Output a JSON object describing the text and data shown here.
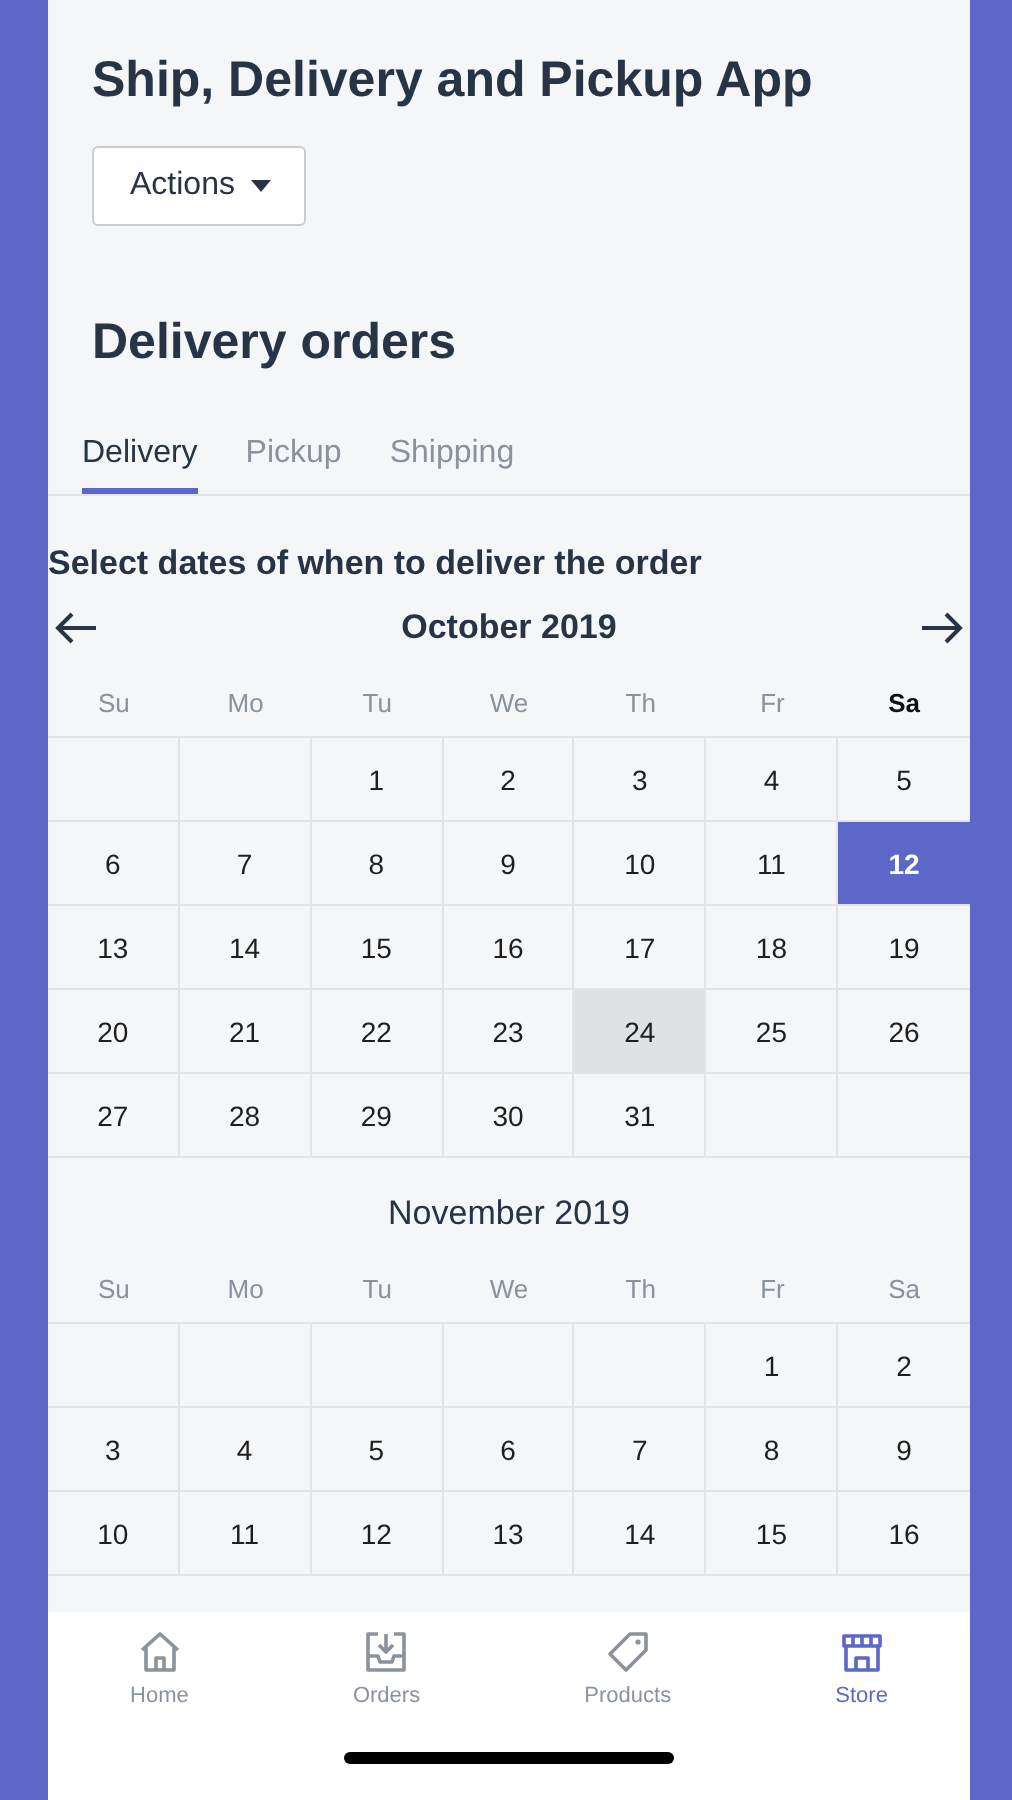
{
  "app_title": "Ship, Delivery and Pickup App",
  "actions_button": {
    "label": "Actions"
  },
  "section_title": "Delivery orders",
  "tabs": [
    {
      "label": "Delivery",
      "selected": true
    },
    {
      "label": "Pickup",
      "selected": false
    },
    {
      "label": "Shipping",
      "selected": false
    }
  ],
  "instruction": "Select dates of when to deliver the order",
  "months": [
    {
      "title": "October 2019",
      "navigation": true,
      "weekdays": [
        {
          "label": "Su",
          "emphasized": false
        },
        {
          "label": "Mo",
          "emphasized": false
        },
        {
          "label": "Tu",
          "emphasized": false
        },
        {
          "label": "We",
          "emphasized": false
        },
        {
          "label": "Th",
          "emphasized": false
        },
        {
          "label": "Fr",
          "emphasized": false
        },
        {
          "label": "Sa",
          "emphasized": true
        }
      ],
      "weeks": [
        [
          {
            "kind": "blank"
          },
          {
            "kind": "blank"
          },
          {
            "kind": "day",
            "day": "1",
            "selected": false,
            "highlighted": false
          },
          {
            "kind": "day",
            "day": "2",
            "selected": false,
            "highlighted": false
          },
          {
            "kind": "day",
            "day": "3",
            "selected": false,
            "highlighted": false
          },
          {
            "kind": "day",
            "day": "4",
            "selected": false,
            "highlighted": false
          },
          {
            "kind": "day",
            "day": "5",
            "selected": false,
            "highlighted": false
          }
        ],
        [
          {
            "kind": "day",
            "day": "6",
            "selected": false,
            "highlighted": false
          },
          {
            "kind": "day",
            "day": "7",
            "selected": false,
            "highlighted": false
          },
          {
            "kind": "day",
            "day": "8",
            "selected": false,
            "highlighted": false
          },
          {
            "kind": "day",
            "day": "9",
            "selected": false,
            "highlighted": false
          },
          {
            "kind": "day",
            "day": "10",
            "selected": false,
            "highlighted": false
          },
          {
            "kind": "day",
            "day": "11",
            "selected": false,
            "highlighted": false
          },
          {
            "kind": "day",
            "day": "12",
            "selected": true,
            "highlighted": false
          }
        ],
        [
          {
            "kind": "day",
            "day": "13",
            "selected": false,
            "highlighted": false
          },
          {
            "kind": "day",
            "day": "14",
            "selected": false,
            "highlighted": false
          },
          {
            "kind": "day",
            "day": "15",
            "selected": false,
            "highlighted": false
          },
          {
            "kind": "day",
            "day": "16",
            "selected": false,
            "highlighted": false
          },
          {
            "kind": "day",
            "day": "17",
            "selected": false,
            "highlighted": false
          },
          {
            "kind": "day",
            "day": "18",
            "selected": false,
            "highlighted": false
          },
          {
            "kind": "day",
            "day": "19",
            "selected": false,
            "highlighted": false
          }
        ],
        [
          {
            "kind": "day",
            "day": "20",
            "selected": false,
            "highlighted": false
          },
          {
            "kind": "day",
            "day": "21",
            "selected": false,
            "highlighted": false
          },
          {
            "kind": "day",
            "day": "22",
            "selected": false,
            "highlighted": false
          },
          {
            "kind": "day",
            "day": "23",
            "selected": false,
            "highlighted": false
          },
          {
            "kind": "day",
            "day": "24",
            "selected": false,
            "highlighted": true
          },
          {
            "kind": "day",
            "day": "25",
            "selected": false,
            "highlighted": false
          },
          {
            "kind": "day",
            "day": "26",
            "selected": false,
            "highlighted": false
          }
        ],
        [
          {
            "kind": "day",
            "day": "27",
            "selected": false,
            "highlighted": false
          },
          {
            "kind": "day",
            "day": "28",
            "selected": false,
            "highlighted": false
          },
          {
            "kind": "day",
            "day": "29",
            "selected": false,
            "highlighted": false
          },
          {
            "kind": "day",
            "day": "30",
            "selected": false,
            "highlighted": false
          },
          {
            "kind": "day",
            "day": "31",
            "selected": false,
            "highlighted": false
          },
          {
            "kind": "blank"
          },
          {
            "kind": "blank"
          }
        ]
      ]
    },
    {
      "title": "November 2019",
      "navigation": false,
      "weekdays": [
        {
          "label": "Su",
          "emphasized": false
        },
        {
          "label": "Mo",
          "emphasized": false
        },
        {
          "label": "Tu",
          "emphasized": false
        },
        {
          "label": "We",
          "emphasized": false
        },
        {
          "label": "Th",
          "emphasized": false
        },
        {
          "label": "Fr",
          "emphasized": false
        },
        {
          "label": "Sa",
          "emphasized": false
        }
      ],
      "weeks": [
        [
          {
            "kind": "blank"
          },
          {
            "kind": "blank"
          },
          {
            "kind": "blank"
          },
          {
            "kind": "blank"
          },
          {
            "kind": "blank"
          },
          {
            "kind": "day",
            "day": "1",
            "selected": false,
            "highlighted": false
          },
          {
            "kind": "day",
            "day": "2",
            "selected": false,
            "highlighted": false
          }
        ],
        [
          {
            "kind": "day",
            "day": "3",
            "selected": false,
            "highlighted": false
          },
          {
            "kind": "day",
            "day": "4",
            "selected": false,
            "highlighted": false
          },
          {
            "kind": "day",
            "day": "5",
            "selected": false,
            "highlighted": false
          },
          {
            "kind": "day",
            "day": "6",
            "selected": false,
            "highlighted": false
          },
          {
            "kind": "day",
            "day": "7",
            "selected": false,
            "highlighted": false
          },
          {
            "kind": "day",
            "day": "8",
            "selected": false,
            "highlighted": false
          },
          {
            "kind": "day",
            "day": "9",
            "selected": false,
            "highlighted": false
          }
        ],
        [
          {
            "kind": "day",
            "day": "10",
            "selected": false,
            "highlighted": false
          },
          {
            "kind": "day",
            "day": "11",
            "selected": false,
            "highlighted": false
          },
          {
            "kind": "day",
            "day": "12",
            "selected": false,
            "highlighted": false
          },
          {
            "kind": "day",
            "day": "13",
            "selected": false,
            "highlighted": false
          },
          {
            "kind": "day",
            "day": "14",
            "selected": false,
            "highlighted": false
          },
          {
            "kind": "day",
            "day": "15",
            "selected": false,
            "highlighted": false
          },
          {
            "kind": "day",
            "day": "16",
            "selected": false,
            "highlighted": false
          }
        ]
      ]
    }
  ],
  "bottom_nav": [
    {
      "kind": "home",
      "label": "Home",
      "selected": false
    },
    {
      "kind": "orders",
      "label": "Orders",
      "selected": false
    },
    {
      "kind": "products",
      "label": "Products",
      "selected": false
    },
    {
      "kind": "store",
      "label": "Store",
      "selected": true
    }
  ]
}
